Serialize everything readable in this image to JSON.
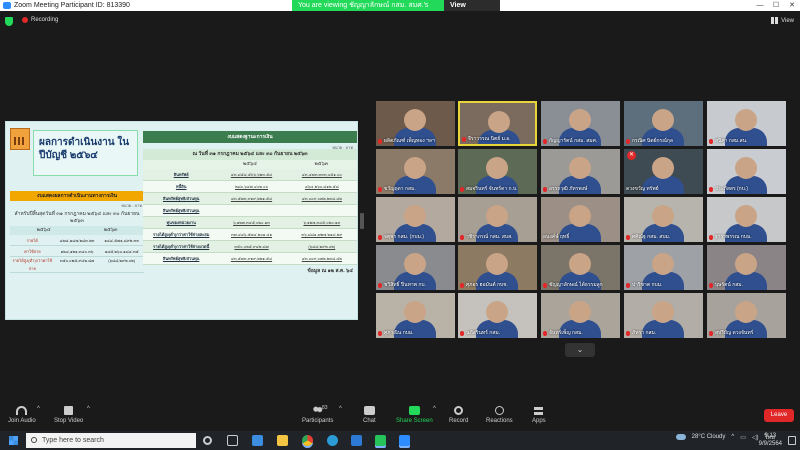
{
  "window": {
    "title": "Zoom Meeting Participant ID: 813390",
    "banner_text": "You are viewing ชัญญาลักษณ์ กสม. สมศ.'s screen",
    "view_options": "View Options"
  },
  "topbar": {
    "recording": "Recording",
    "view": "View"
  },
  "slide": {
    "heading": "ผลการดำเนินงาน ในปีบัญชี ๒๕๖๔",
    "left_title": "งบแสดงผลการดำเนินงานทางการเงิน",
    "left_unit": "หน่วย : บาท",
    "left_period": "สำหรับปีสิ้นสุดวันที่ ๓๑ กรกฎาคม ๒๕๖๔ และ ๓๐ กันยายน ๒๕๖๓",
    "left_cols": [
      "๒๕๖๔",
      "๒๕๖๓"
    ],
    "left_rows": [
      {
        "label": "รายได้",
        "v1": "๔๗๔,๑๔๗,๒๘๓.๒๓",
        "v2": "๑๔๔,๕๗๑,๘๙๒.๓๓"
      },
      {
        "label": "ค่าใช้จ่าย",
        "v1": "๑๒๔,๑๒๑,๓๔๐.๓๖",
        "v2": "๑๔๕,๒๖๐,๑๘๔.๓๕"
      },
      {
        "label": "รายได้สูง(ต่ำ)กว่าค่าใช้จ่าย",
        "v1": "๓๕๐,๐๒๕,๙๔๒.๘๗",
        "v2": "(๖๘๘,๒๙๒.๐๒)"
      }
    ],
    "right_title": "งบแสดงฐานะการเงิน",
    "right_unit": "หน่วย : บาท",
    "right_date": "ณ วันที่ ๓๑ กรกฎาคม ๒๕๖๔ และ ๓๐ กันยายน ๒๕๖๓",
    "right_cols": [
      "",
      "๒๕๖๔",
      "๒๕๖๓"
    ],
    "right_rows": [
      {
        "label": "สินทรัพย์",
        "v1": "๔๓,๘๕๔,๕๖๖,๖๒๓.๕๔",
        "v2": "๔๓,๔๗๓,๓๓๓,๐๕๑.๐๐"
      },
      {
        "label": "หนี้สิน",
        "v1": "๒๘๐,๖๔๗,๔๐๒.๐๐",
        "v2": "๔๖๔,๒๖๐,๘๑๒.๕๘"
      },
      {
        "label": "สินทรัพย์สุทธิ/ส่วนทุน",
        "v1": "๔๓,๕๗๓,๙๑๙,๒๒๑.๕๔",
        "v2": "๔๓,๐๐๙,๐๗๒,๒๓๘.๔๒"
      },
      {
        "label": "สินทรัพย์สุทธิ/ส่วนทุน",
        "v1": "",
        "v2": ""
      },
      {
        "label": "ทุนของหน่วยงาน",
        "v1": "๖,๑๒๗,๓๔๕,๐๒๐.๑๓",
        "v2": "๖,๑๒๗,๓๔๕,๐๒๐.๑๓"
      },
      {
        "label": "รายได้สูง(ต่ำ)กว่าค่าใช้จ่ายสะสม",
        "v1": "๓๗,๔๔๖,๕๗๔,๒๐๑.๔๑",
        "v2": "๓๖,๘๘๑,๗๒๗,๒๑๘.๒๙"
      },
      {
        "label": "รายได้สูง(ต่ำ)กว่าค่าใช้จ่ายงวดนี้",
        "v1": "๓๕๐,๐๒๕,๙๔๒.๘๗",
        "v2": "(๖๘๘,๒๙๒.๐๒)"
      },
      {
        "label": "สินทรัพย์สุทธิ/ส่วนทุน",
        "v1": "๔๓,๕๗๓,๙๑๙,๒๒๑.๕๔",
        "v2": "๔๓,๐๐๙,๐๗๒,๒๓๘.๔๒"
      }
    ],
    "footnote": "ข้อมูล ณ ๑๒ ส.ค. ๖๔"
  },
  "participants": [
    {
      "name": "ผลิตภัณฑ์ เพ็ญทอง ฯลฯ",
      "muted": true,
      "bg": "#6d5a4a"
    },
    {
      "name": "จีราวรรณ นิตย์ ม.อ.",
      "muted": true,
      "bg": "#7b6b5e",
      "active": true
    },
    {
      "name": "กัญญารัตน์ กสม. สมศ.",
      "muted": true,
      "bg": "#8a8f96"
    },
    {
      "name": "กรณิศ นิตย์กรณ์กุล",
      "muted": true,
      "bg": "#5d6f7c"
    },
    {
      "name": "สุนิศา กสม.สน.",
      "muted": true,
      "bg": "#c7cbd0"
    },
    {
      "name": "ขวัญฤดา กสม.",
      "muted": true,
      "bg": "#8c7a68"
    },
    {
      "name": "สมจรินทร์ จันทร์ดา ก.บ.",
      "muted": true,
      "bg": "#5d6a55"
    },
    {
      "name": "อรรถวุฒิ ภัทรพงษ์",
      "muted": true,
      "bg": "#9c9a97"
    },
    {
      "name": "ดวงขวัญ ทรัพย์",
      "muted": false,
      "stopped": true,
      "bg": "#3f4b52"
    },
    {
      "name": "ประภัสสร (กบ.)",
      "muted": true,
      "bg": "#c9ccd0"
    },
    {
      "name": "จตุพร กสม. (กบม.)",
      "muted": true,
      "bg": "#b3a99f"
    },
    {
      "name": "วชิราภรณ์ กสม. สบส.",
      "muted": true,
      "bg": "#a89f94"
    },
    {
      "name": "อนงค์ษ์ ฤทธิ์",
      "muted": false,
      "bg": "#9b8f86"
    },
    {
      "name": "ศศิณัฐ กสม. สบม.",
      "muted": true,
      "bg": "#b7b4ad"
    },
    {
      "name": "ฐาราพรรณ กบม.",
      "muted": true,
      "bg": "#c7c8c9"
    },
    {
      "name": "ชวิสิทธิ์ ปิ่นทาพ กบ.",
      "muted": true,
      "bg": "#8a8b8f"
    },
    {
      "name": "ศุภอร ฮอมันต์ กบช.",
      "muted": true,
      "bg": "#8d7a63"
    },
    {
      "name": "ชัญญาลักษณ์ ได้ธรรมลูก",
      "muted": true,
      "bg": "#7a7568"
    },
    {
      "name": "ปาริชาต กบม.",
      "muted": true,
      "bg": "#9ea2a6"
    },
    {
      "name": "บุษรัตน์ กสม.",
      "muted": true,
      "bg": "#8b8486"
    },
    {
      "name": "ศูภาณิน กบม.",
      "muted": true,
      "bg": "#b9b2a7"
    },
    {
      "name": "นภัสรินทร์ กสม.",
      "muted": true,
      "bg": "#c5c2bd"
    },
    {
      "name": "จันทร์เพ็ญ กสม.",
      "muted": true,
      "bg": "#aaa49a"
    },
    {
      "name": "ภัทรา กสม.",
      "muted": true,
      "bg": "#b2ada6"
    },
    {
      "name": "สุปรียัญ ดวงจันทร์",
      "muted": true,
      "bg": "#a7a29c"
    }
  ],
  "toolbar": {
    "join_audio": "Join Audio",
    "stop_video": "Stop Video",
    "participants": "Participants",
    "participant_count": "83",
    "chat": "Chat",
    "share_screen": "Share Screen",
    "record": "Record",
    "reactions": "Reactions",
    "apps": "Apps",
    "leave": "Leave"
  },
  "taskbar": {
    "search_placeholder": "Type here to search",
    "weather": "28°C  Cloudy",
    "lang": "ไทย",
    "time": "9:13",
    "date": "9/9/2564"
  }
}
